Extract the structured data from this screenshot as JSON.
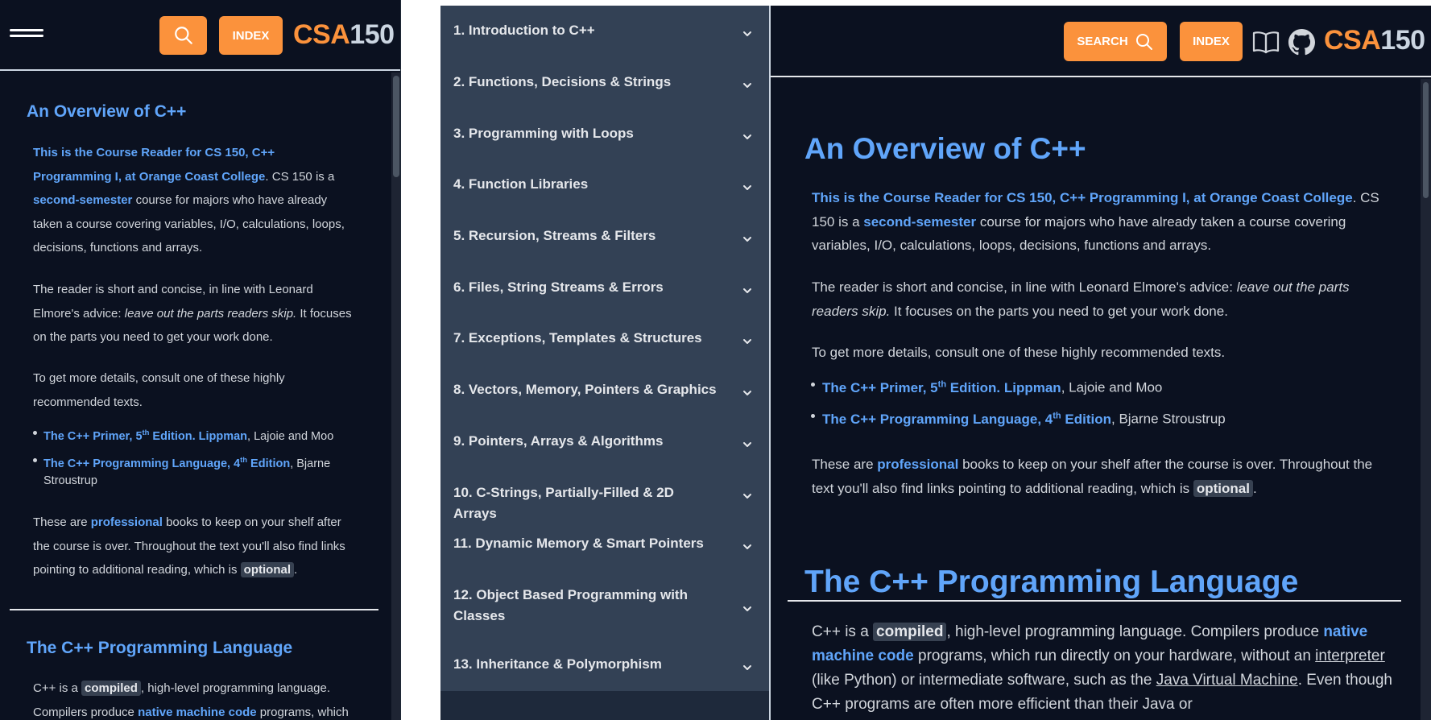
{
  "mobile": {
    "index_label": "INDEX",
    "logo_csa": "CSA",
    "logo_num": "150",
    "overview_title": "An Overview of C++",
    "intro_link": "This is the Course Reader for CS 150, C++ Programming I, at Orange Coast College",
    "intro_rest_a": ". CS 150 is a ",
    "second_semester": "second-semester",
    "intro_rest_b": " course for majors who have already taken a course covering variables, I/O, calculations, loops, decisions, functions and arrays.",
    "para2_a": "The reader is short and concise, in line with Leonard Elmore's advice: ",
    "para2_italic": "leave out the parts readers skip.",
    "para2_b": " It focuses on the parts you need to get your work done.",
    "para3": "To get more details, consult one of these highly recommended texts.",
    "book1_title_a": "The C++ Primer, 5",
    "book1_sup": "th",
    "book1_title_b": " Edition. Lippman",
    "book1_authors": ", Lajoie and Moo",
    "book2_title_a": "The C++ Programming Language, 4",
    "book2_sup": "th",
    "book2_title_b": " Edition",
    "book2_authors": ", Bjarne Stroustrup",
    "para4_a": "These are ",
    "professional": "professional",
    "para4_b": " books to keep on your shelf after the course is over. Throughout the text you'll also find links pointing to additional reading, which is ",
    "optional": "optional",
    "para4_c": ".",
    "lang_title": "The C++ Programming Language",
    "lang_a": "C++ is a ",
    "compiled": "compiled",
    "lang_b": ", high-level programming language. Compilers produce ",
    "native_code": "native machine code",
    "lang_c": " programs, which"
  },
  "nav": {
    "items": [
      "1. Introduction to C++",
      "2. Functions, Decisions & Strings",
      "3. Programming with Loops",
      "4. Function Libraries",
      "5. Recursion, Streams & Filters",
      "6. Files, String Streams & Errors",
      "7. Exceptions, Templates & Structures",
      "8. Vectors, Memory, Pointers & Graphics",
      "9. Pointers, Arrays & Algorithms",
      "10. C-Strings, Partially-Filled & 2D Arrays",
      "11. Dynamic Memory & Smart Pointers",
      "12. Object Based Programming with Classes",
      "13. Inheritance & Polymorphism"
    ]
  },
  "desktop": {
    "search_label": "SEARCH",
    "index_label": "INDEX",
    "logo_csa": "CSA",
    "logo_num": "150",
    "overview_title": "An Overview of C++",
    "intro_link": "This is the Course Reader for CS 150, C++ Programming I, at Orange Coast College",
    "intro_rest_a": ". CS 150 is a ",
    "second_semester": "second-semester",
    "intro_rest_b": " course for majors who have already taken a course covering variables, I/O, calculations, loops, decisions, functions and arrays.",
    "para2_a": "The reader is short and concise, in line with Leonard Elmore's advice: ",
    "para2_italic": "leave out the parts readers skip.",
    "para2_b": " It focuses on the parts you need to get your work done.",
    "para3": "To get more details, consult one of these highly recommended texts.",
    "book1_title_a": "The C++ Primer, 5",
    "book1_sup": "th",
    "book1_title_b": " Edition. Lippman",
    "book1_authors": ", Lajoie and Moo",
    "book2_title_a": "The C++ Programming Language, 4",
    "book2_sup": "th",
    "book2_title_b": " Edition",
    "book2_authors": ", Bjarne Stroustrup",
    "para4_a": "These are ",
    "professional": "professional",
    "para4_b": " books to keep on your shelf after the course is over. Throughout the text you'll also find links pointing to additional reading, which is ",
    "optional": "optional",
    "para4_c": ".",
    "lang_title": "The C++ Programming Language",
    "lang_a": "C++ is a ",
    "compiled": "compiled",
    "lang_b": ", high-level programming language. Compilers produce ",
    "native_code": "native machine code",
    "lang_c": " programs, which run directly on your hardware, without an ",
    "interpreter": "interpreter ",
    "lang_d": "(like Python) or intermediate software, such as the ",
    "jvm": "Java Virtual Machine",
    "lang_e": ". Even though C++ programs are often more efficient than their Java or"
  },
  "icons": {
    "menu": "hamburger-menu-icon",
    "search": "search-icon",
    "chevron": "chevron-down-icon",
    "book": "book-open-icon",
    "github": "github-icon"
  },
  "colors": {
    "background": "#0b1120",
    "accent": "#fb923c",
    "link": "#60a5fa",
    "nav_bg": "#334155",
    "text": "#d1d5db"
  }
}
